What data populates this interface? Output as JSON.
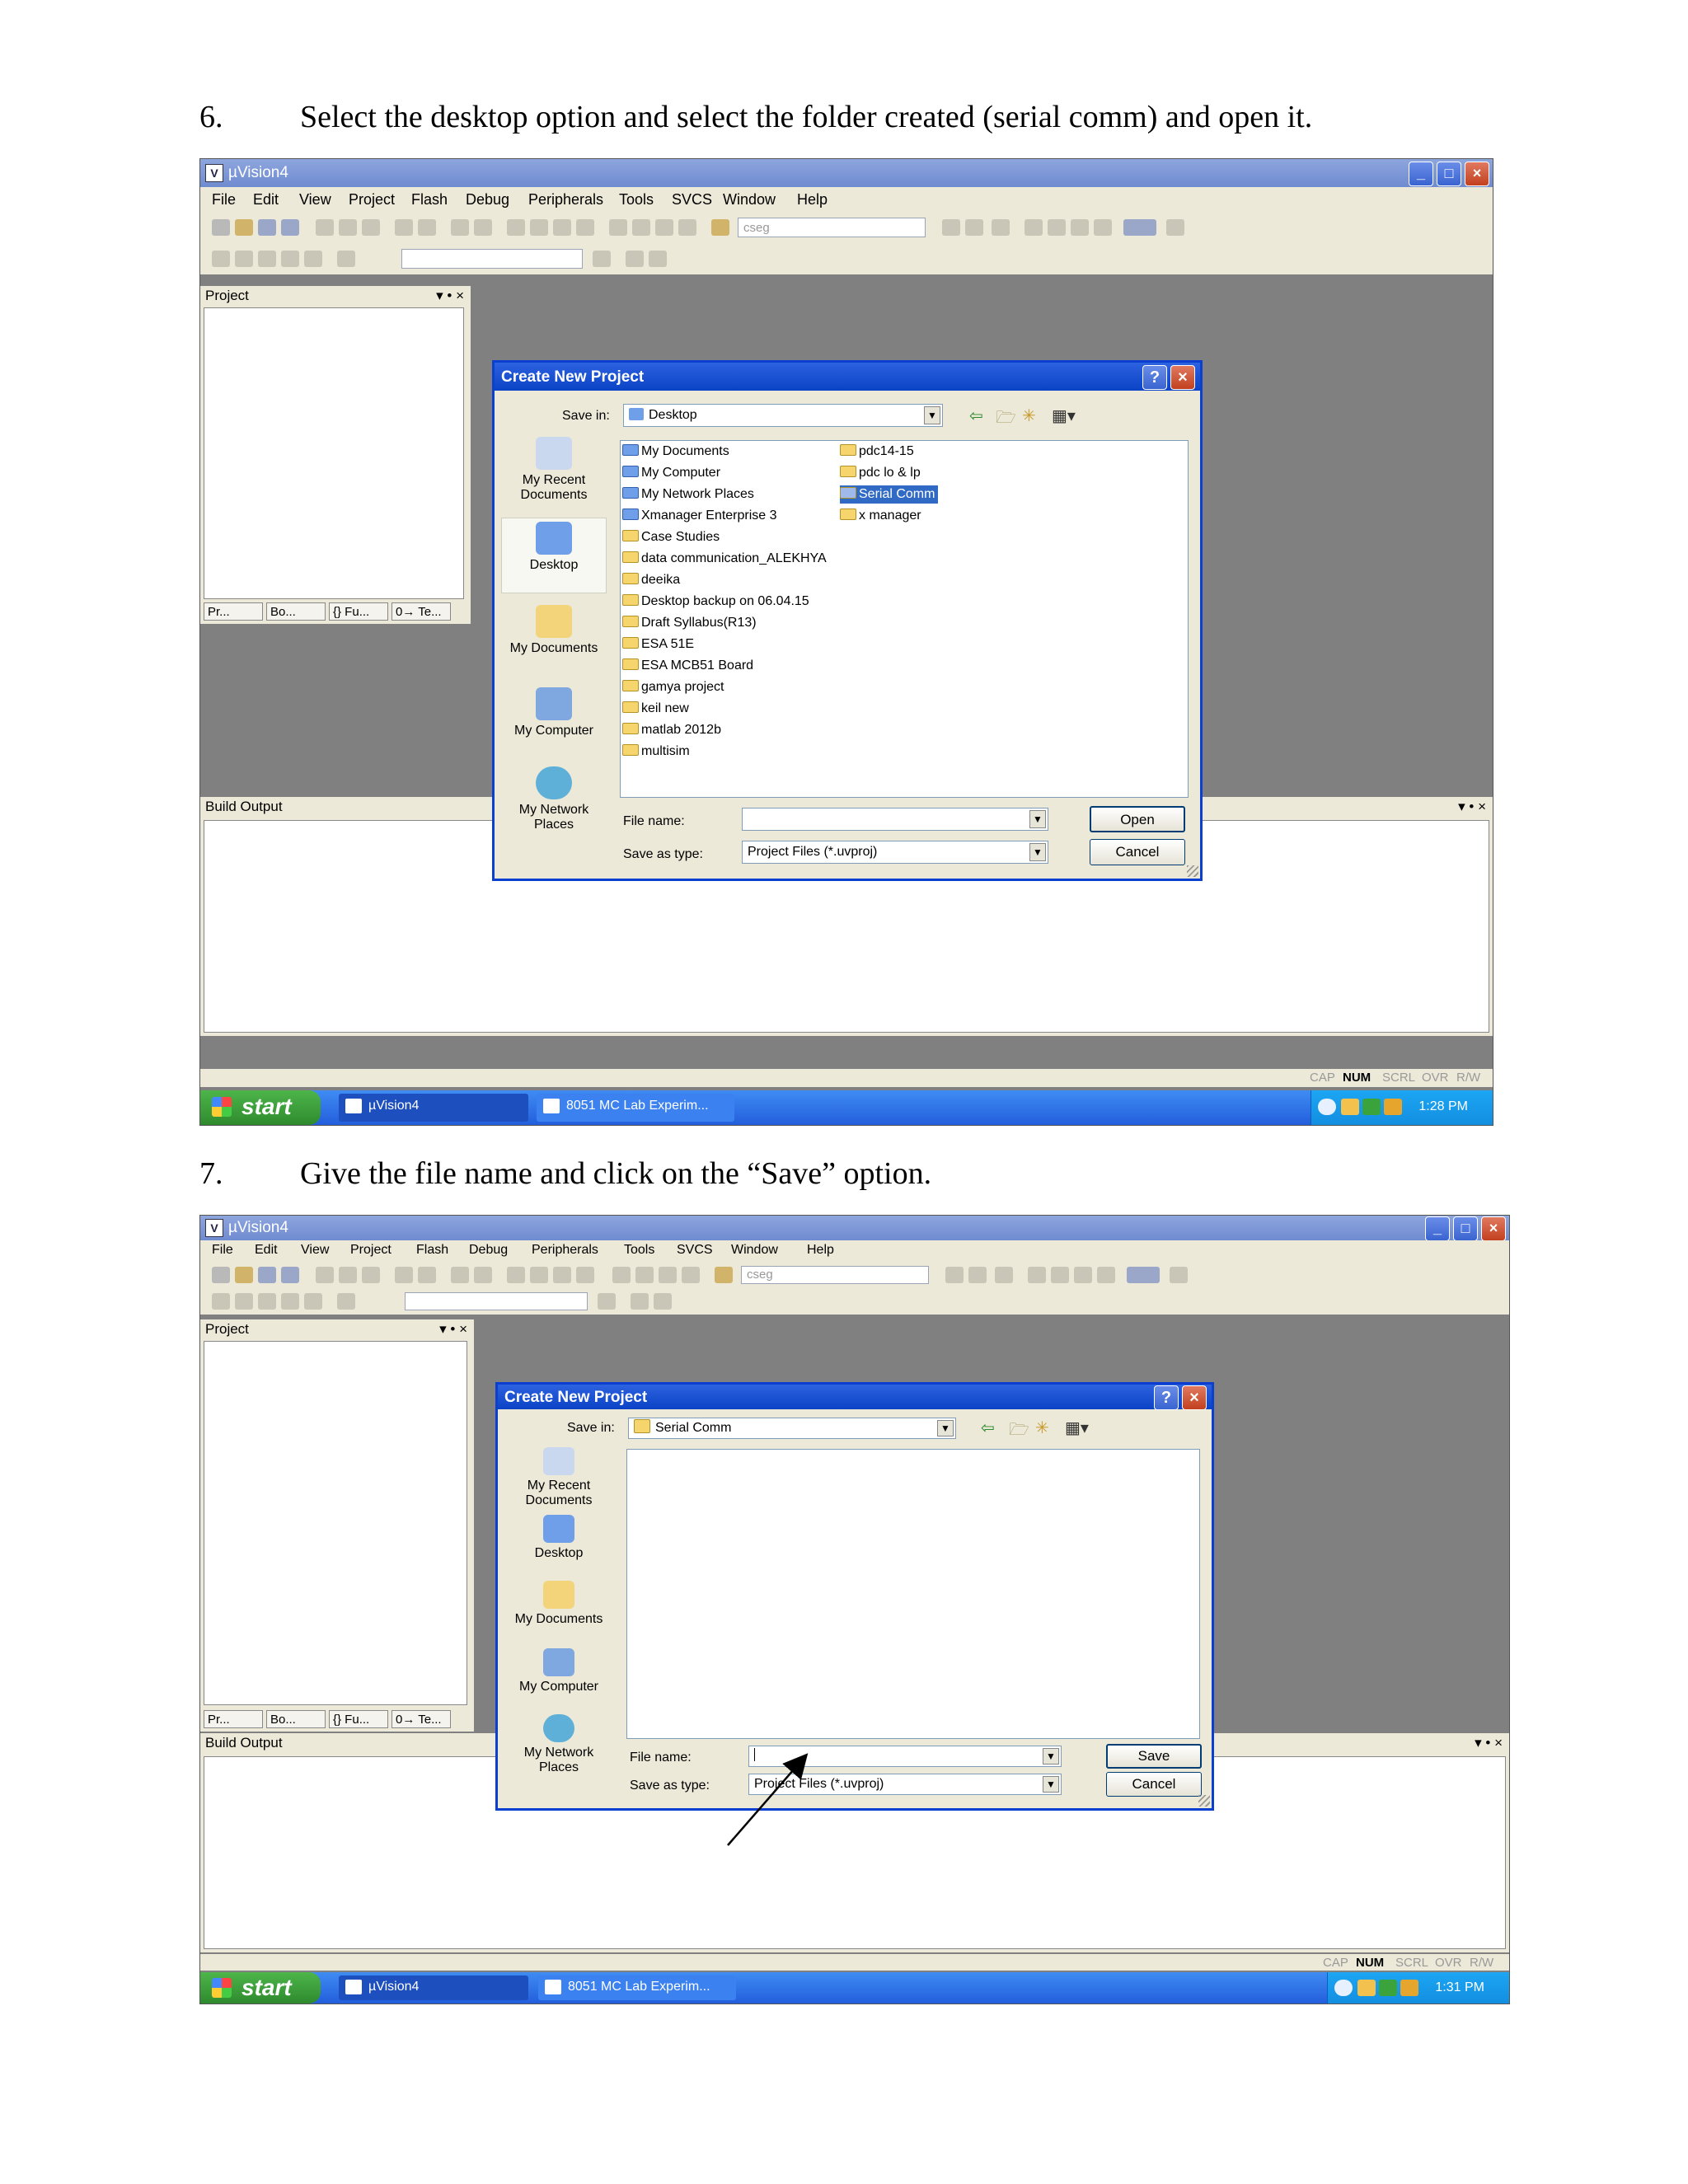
{
  "step6": {
    "number": "6.",
    "text": "Select the desktop option and select the folder created (serial comm) and open it."
  },
  "step7": {
    "number": "7.",
    "text": "Give the file name and click on the “Save” option."
  },
  "window": {
    "title": "µVision4",
    "menu": [
      "File",
      "Edit",
      "View",
      "Project",
      "Flash",
      "Debug",
      "Peripherals",
      "Tools",
      "SVCS",
      "Window",
      "Help"
    ],
    "toolbar_combo": "cseg",
    "project_pane_title": "Project",
    "pane_tabs": [
      "Pr...",
      "Bo...",
      "{} Fu...",
      "0→ Te..."
    ],
    "build_output_title": "Build Output",
    "status": [
      "CAP",
      "NUM",
      "SCRL",
      "OVR",
      "R/W"
    ]
  },
  "taskbar": {
    "start": "start",
    "items": [
      "µVision4",
      "8051 MC Lab Experim..."
    ],
    "time1": "1:28 PM",
    "time2": "1:31 PM"
  },
  "dialog1": {
    "title": "Create New Project",
    "save_in_label": "Save in:",
    "save_in_value": "Desktop",
    "places": [
      "My Recent Documents",
      "Desktop",
      "My Documents",
      "My Computer",
      "My Network Places"
    ],
    "files_col1": [
      "My Documents",
      "My Computer",
      "My Network Places",
      "Xmanager Enterprise 3",
      "Case Studies",
      "data communication_ALEKHYA",
      "deeika",
      "Desktop backup on 06.04.15",
      "Draft Syllabus(R13)",
      "ESA 51E",
      "ESA MCB51 Board",
      "gamya project",
      "keil new",
      "matlab 2012b",
      "multisim"
    ],
    "files_col2": [
      "pdc14-15",
      "pdc lo & lp",
      "Serial Comm",
      "x manager"
    ],
    "selected": "Serial Comm",
    "file_name_label": "File name:",
    "file_name_value": "",
    "save_type_label": "Save as type:",
    "save_type_value": "Project Files (*.uvproj)",
    "primary_button": "Open",
    "cancel_button": "Cancel"
  },
  "dialog2": {
    "title": "Create New Project",
    "save_in_label": "Save in:",
    "save_in_value": "Serial Comm",
    "places": [
      "My Recent Documents",
      "Desktop",
      "My Documents",
      "My Computer",
      "My Network Places"
    ],
    "file_name_label": "File name:",
    "file_name_value": "",
    "save_type_label": "Save as type:",
    "save_type_value": "Project Files (*.uvproj)",
    "primary_button": "Save",
    "cancel_button": "Cancel"
  },
  "icons": [
    "app-icon",
    "minimize-icon",
    "maximize-icon",
    "close-icon",
    "help-icon",
    "back-arrow-icon",
    "up-folder-icon",
    "new-folder-icon",
    "views-menu-icon",
    "folder-icon",
    "start-flag-icon",
    "pointer-arrow"
  ]
}
